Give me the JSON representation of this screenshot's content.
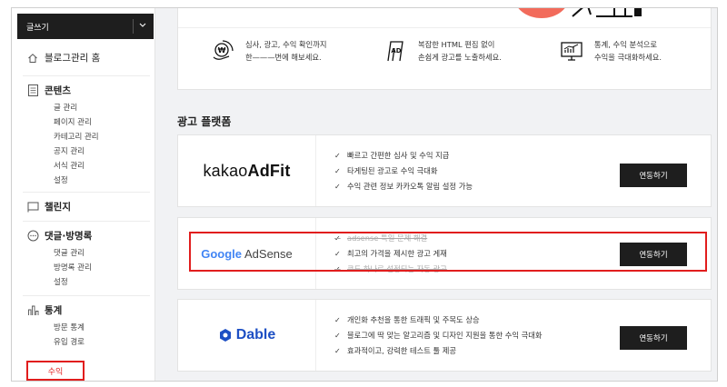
{
  "sidebar": {
    "write_button": "글쓰기",
    "home": "블로그관리 홈",
    "content": {
      "title": "콘텐츠",
      "items": [
        "글 관리",
        "페이지 관리",
        "카테고리 관리",
        "공지 관리",
        "서식 관리",
        "설정"
      ]
    },
    "challenge": {
      "title": "챌린지"
    },
    "comments": {
      "title": "댓글·방명록",
      "items": [
        "댓글 관리",
        "방명록 관리",
        "설정"
      ]
    },
    "stats": {
      "title": "통계",
      "items": [
        "방문 통계",
        "유입 경로"
      ]
    },
    "revenue": "수익"
  },
  "features": [
    {
      "icon": "won-coin-icon",
      "line1": "심사, 광고, 수익 확인까지",
      "line2": "한———번에 해보세요."
    },
    {
      "icon": "ad-board-icon",
      "line1": "복잡한 HTML 편집 없이",
      "line2": "손쉽게 광고를 노출하세요."
    },
    {
      "icon": "chart-monitor-icon",
      "line1": "통계, 수익 분석으로",
      "line2": "수익을 극대화하세요."
    }
  ],
  "section_title": "광고 플랫폼",
  "platforms": [
    {
      "name": "kakaoAdFit",
      "logo_light": "kakao",
      "logo_bold": "AdFit",
      "bullets": [
        "빠르고 간편한 심사 및 수익 지급",
        "타게팅된 광고로 수익 극대화",
        "수익 관련 정보 카카오톡 알림 설정 가능"
      ],
      "button": "연동하기"
    },
    {
      "name": "Google AdSense",
      "logo_google": "Google",
      "logo_adsense": "AdSense",
      "bullets": [
        "adsense 특일 문제 해결",
        "최고의 가격을 제시한 광고 게재",
        "코드 하나로 설정되는 자동 광고"
      ],
      "button": "연동하기"
    },
    {
      "name": "Dable",
      "logo_text": "Dable",
      "bullets": [
        "개인화 추천을 통한 트래픽 및 주목도 상승",
        "블로그에 딱 맞는 알고리즘 및 디자인 지원을 통한 수익 극대화",
        "효과적이고, 강력한 테스트 툴 제공"
      ],
      "button": "연동하기"
    }
  ],
  "colors": {
    "highlight": "#e11d1d",
    "button_bg": "#1e1e1e",
    "dable_blue": "#1d4fc4",
    "deco_coral": "#f26b5b"
  }
}
